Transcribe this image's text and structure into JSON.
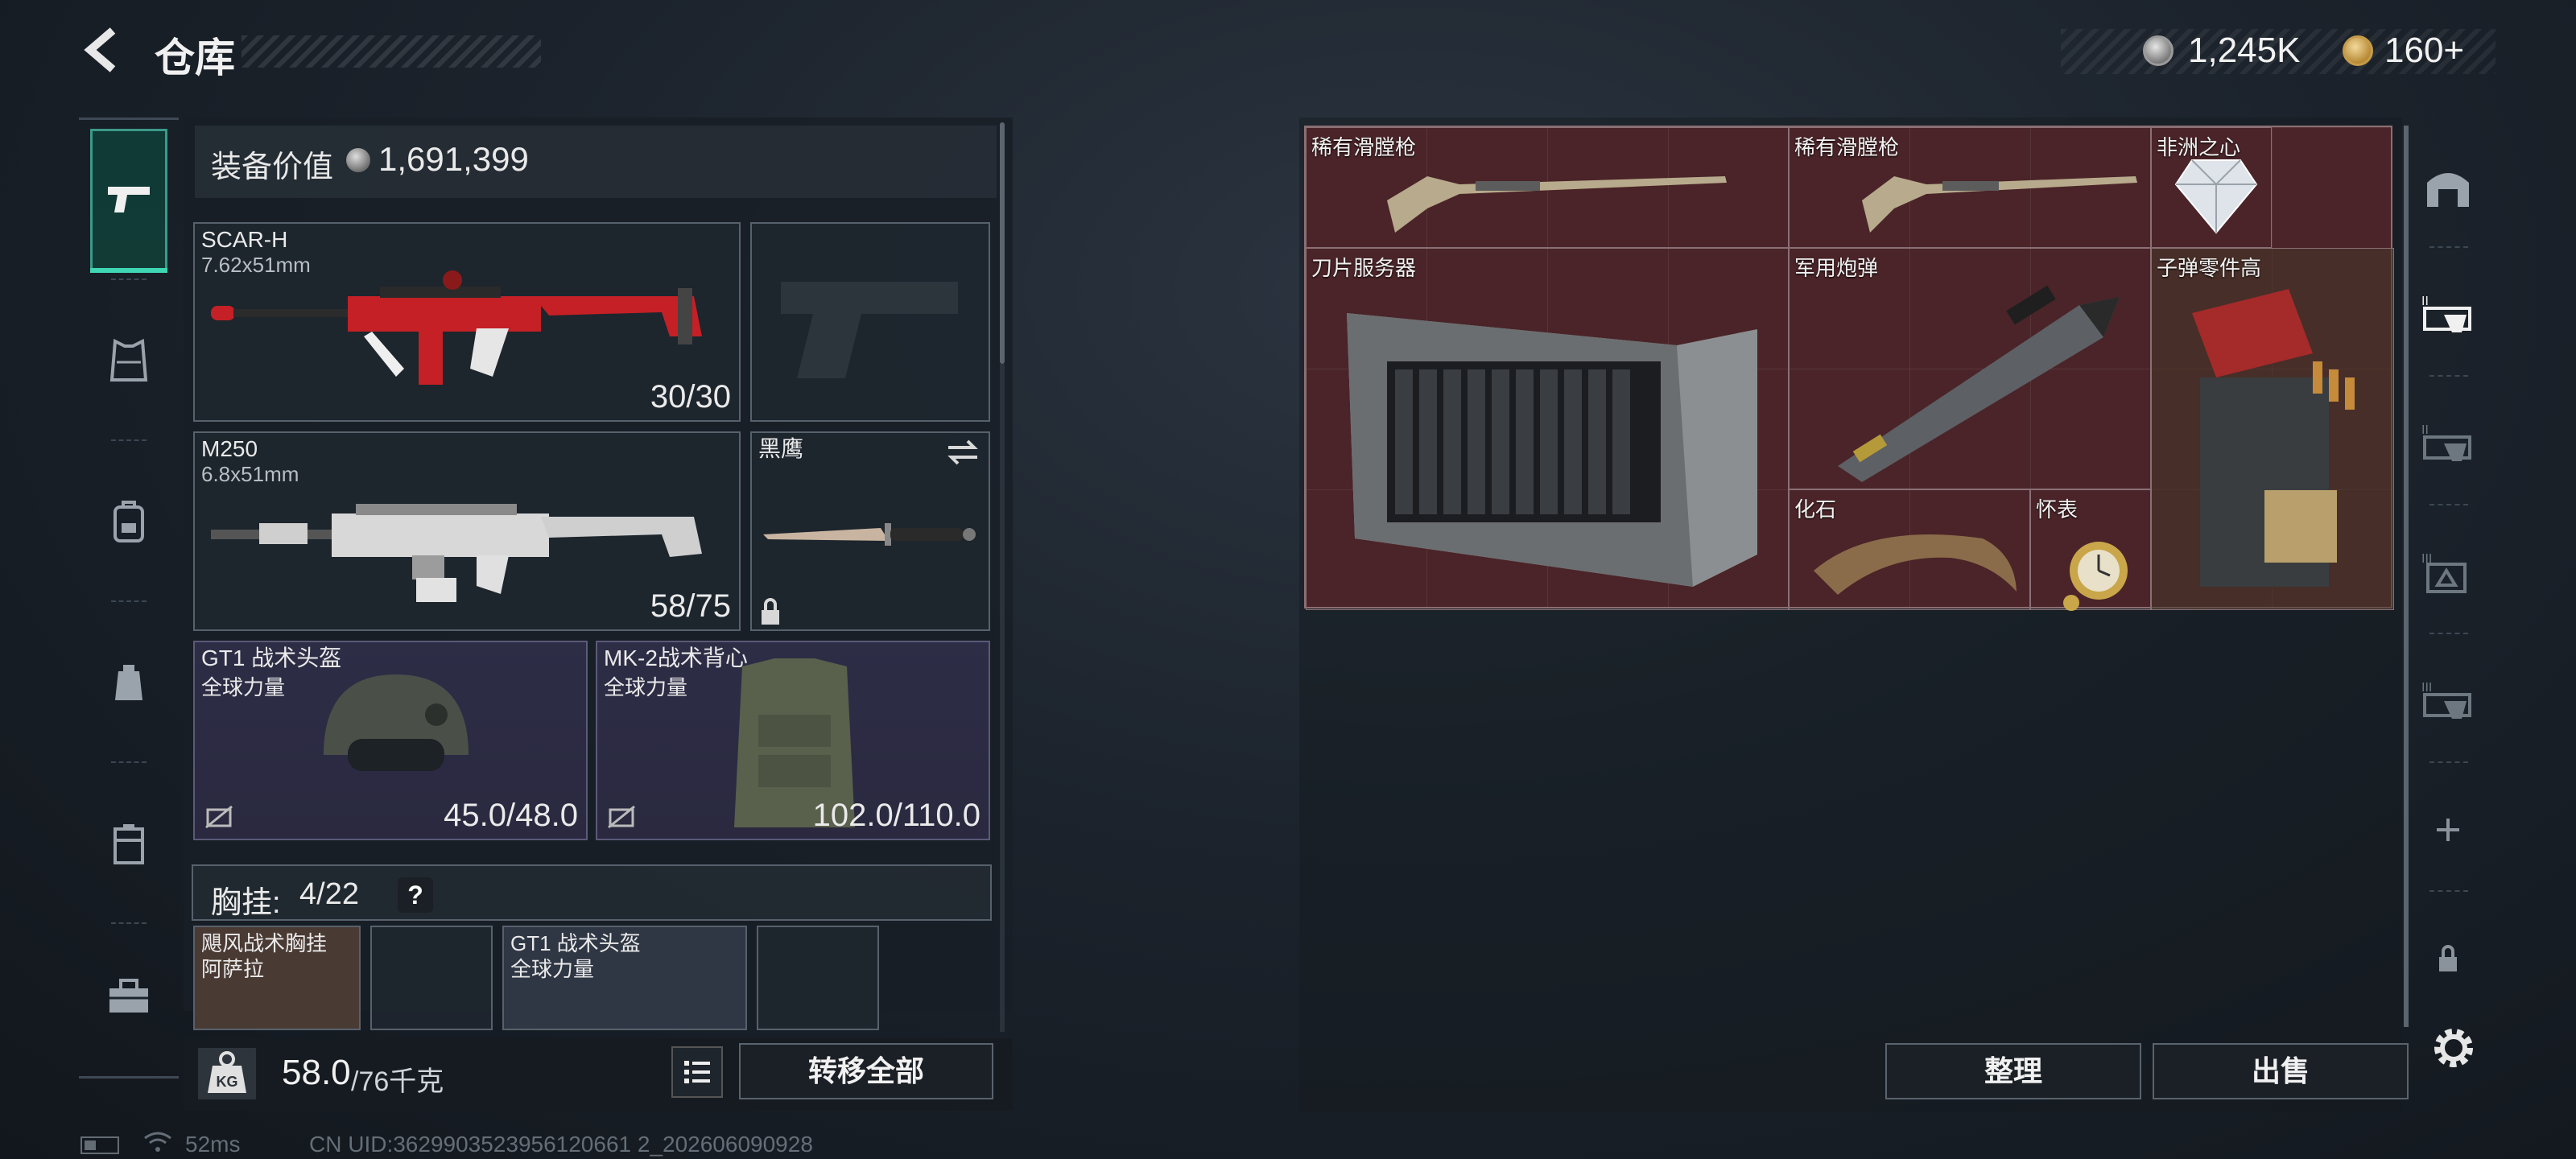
{
  "header": {
    "title": "仓库",
    "currency": [
      {
        "name": "silver-coin",
        "value": "1,245K",
        "color": "#a8a8a8"
      },
      {
        "name": "gold-coin",
        "value": "160+",
        "color": "#c59b4a"
      }
    ]
  },
  "left_categories": {
    "items": [
      {
        "name": "weapons",
        "icon": "pistol-icon",
        "active": true
      },
      {
        "name": "armor",
        "icon": "vest-icon",
        "active": false
      },
      {
        "name": "backpack",
        "icon": "backpack-icon",
        "active": false
      },
      {
        "name": "pouch",
        "icon": "pouch-icon",
        "active": false
      },
      {
        "name": "case",
        "icon": "case-icon",
        "active": false
      },
      {
        "name": "toolbox",
        "icon": "toolbox-icon",
        "active": false
      }
    ]
  },
  "equipment": {
    "value_label": "装备价值",
    "value": "1,691,399",
    "slots": {
      "primary": {
        "name": "SCAR-H",
        "caliber": "7.62x51mm",
        "ammo": "30/30"
      },
      "secondary": {
        "name": "M250",
        "caliber": "6.8x51mm",
        "ammo": "58/75"
      },
      "melee": {
        "name": "黑鹰"
      },
      "helmet": {
        "name": "GT1 战术头盔",
        "tag": "全球力量",
        "durability": "45.0/48.0"
      },
      "vest": {
        "name": "MK-2战术背心",
        "tag": "全球力量",
        "durability": "102.0/110.0"
      }
    },
    "chest_rig": {
      "label": "胸挂:",
      "count": "4/22",
      "help": "?",
      "items": [
        {
          "name": "飓风战术胸挂",
          "tag": "阿萨拉"
        },
        {
          "name": "GT1 战术头盔",
          "tag": "全球力量"
        }
      ]
    }
  },
  "weight": {
    "current": "58.0",
    "max": "/76千克",
    "icon_label": "KG"
  },
  "buttons": {
    "transfer_all": "转移全部",
    "sort": "整理",
    "sell": "出售"
  },
  "storage": {
    "items": [
      {
        "label": "稀有滑膛枪"
      },
      {
        "label": "稀有滑膛枪"
      },
      {
        "label": "非洲之心"
      },
      {
        "label": "刀片服务器"
      },
      {
        "label": "军用炮弹"
      },
      {
        "label": "子弹零件高"
      },
      {
        "label": "化石"
      },
      {
        "label": "怀表"
      }
    ]
  },
  "status": {
    "ping": "52ms",
    "uid": "CN UID:3629903523956120661 2_202606090928"
  }
}
